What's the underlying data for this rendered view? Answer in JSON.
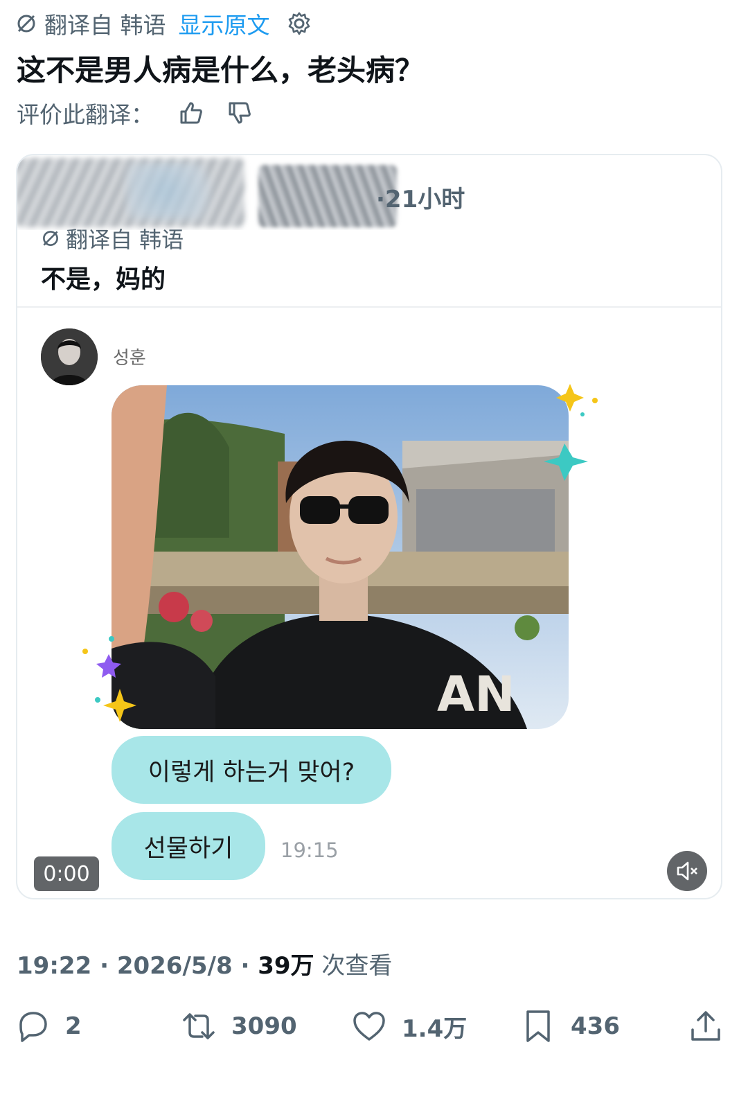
{
  "translation": {
    "label": "翻译自 韩语",
    "show_original": "显示原文"
  },
  "tweet": {
    "text": "这不是男人病是什么，老头病？",
    "rate_label": "评价此翻译："
  },
  "quote": {
    "time": "·21小时",
    "translation_label": "翻译自 韩语",
    "text": "不是，妈的"
  },
  "media": {
    "sender_name": "성훈",
    "bubble1": "이렇게 하는거 맞어?",
    "bubble2": "선물하기",
    "message_time": "19:15",
    "video_time": "0:00",
    "bubble_color": "#a8e6e8"
  },
  "meta": {
    "time": "19:22",
    "date": "2026/5/8",
    "views_count": "39万",
    "views_label": "次查看"
  },
  "actions": {
    "replies": "2",
    "retweets": "3090",
    "likes": "1.4万",
    "bookmarks": "436"
  },
  "icons": [
    "translate-slash-icon",
    "gear-icon",
    "thumbs-up-icon",
    "thumbs-down-icon",
    "mute-icon",
    "reply-icon",
    "retweet-icon",
    "like-icon",
    "bookmark-icon",
    "share-icon"
  ],
  "colors": {
    "accent": "#1d9bf0",
    "muted": "#536471",
    "text": "#0f1419"
  }
}
